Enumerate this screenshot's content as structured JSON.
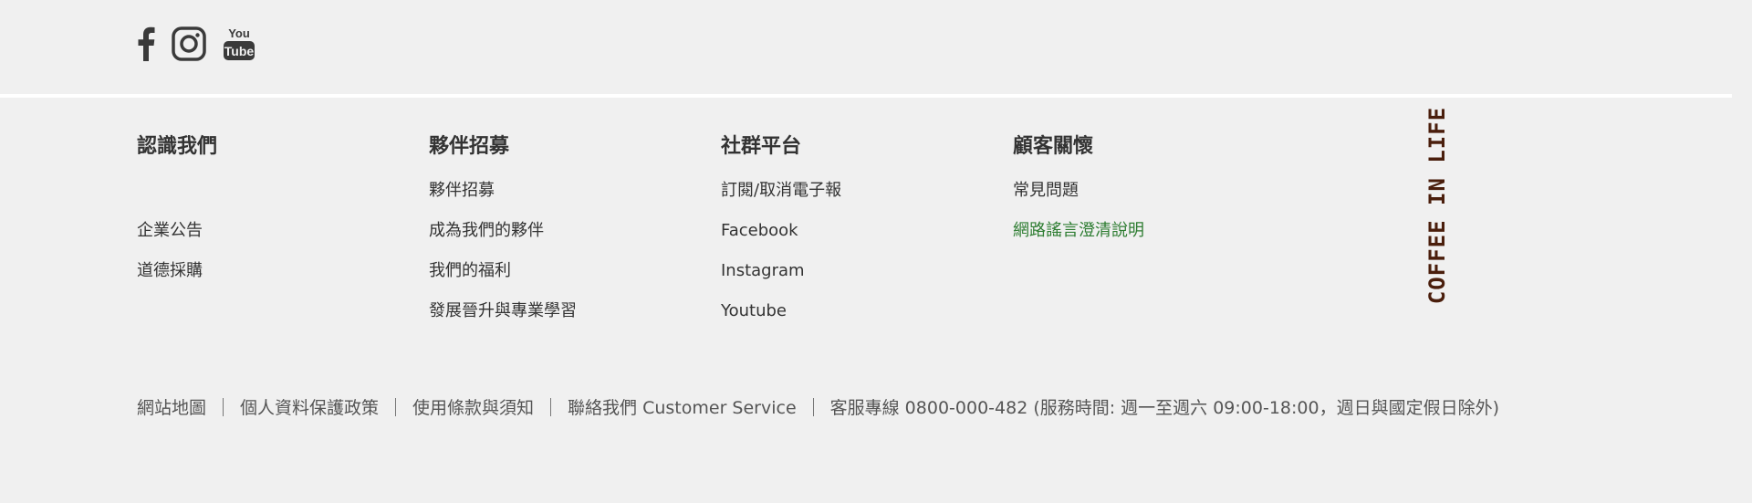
{
  "social": {
    "icons": [
      "facebook-icon",
      "instagram-icon",
      "youtube-icon"
    ],
    "youtube_text_top": "You",
    "youtube_text_bottom": "Tube",
    "icon_color": "#3a3a3a"
  },
  "columns": [
    {
      "title": "認識我們",
      "items": [
        "",
        "企業公告",
        "道德採購"
      ]
    },
    {
      "title": "夥伴招募",
      "items": [
        "夥伴招募",
        "成為我們的夥伴",
        "我們的福利",
        "發展晉升與專業學習"
      ]
    },
    {
      "title": "社群平台",
      "items": [
        "訂閱/取消電子報",
        "Facebook",
        "Instagram",
        "Youtube"
      ]
    },
    {
      "title": "顧客關懷",
      "items": [
        "常見問題",
        "網路謠言澄清說明"
      ]
    }
  ],
  "slogan": "COFFEE IN LIFE",
  "bottom_links": {
    "sitemap": "網站地圖",
    "privacy": "個人資料保護政策",
    "terms": "使用條款與須知",
    "contact": "聯絡我們 Customer Service",
    "hotline": "客服專線 0800-000-482 (服務時間: 週一至週六 09:00-18:00，週日與國定假日除外)"
  },
  "colors": {
    "background": "#f0f0f0",
    "text": "#333333",
    "highlight_link": "#2e7d32",
    "slogan": "#4a1e0c"
  }
}
